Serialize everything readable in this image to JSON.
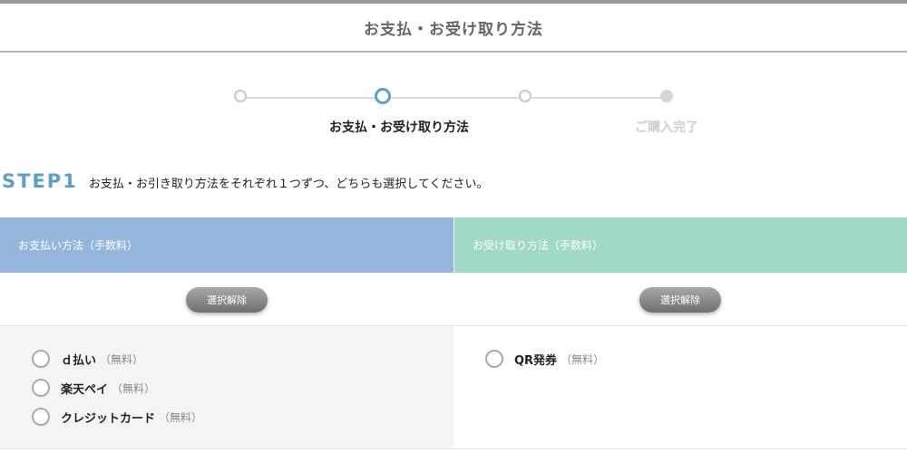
{
  "header": {
    "title": "お支払・お受け取り方法"
  },
  "stepper": {
    "current_label": "お支払・お受け取り方法",
    "final_label": "ご購入完了"
  },
  "step1": {
    "tag": "STEP1",
    "instruction": "お支払・お引き取り方法をそれぞれ１つずつ、どちらも選択してください。"
  },
  "payment": {
    "header": "お支払い方法（手数料）",
    "clear_label": "選択解除",
    "options": [
      {
        "name": "ｄ払い",
        "fee": "（無料）"
      },
      {
        "name": "楽天ペイ",
        "fee": "（無料）"
      },
      {
        "name": "クレジットカード",
        "fee": "（無料）"
      }
    ]
  },
  "receive": {
    "header": "お受け取り方法（手数料）",
    "clear_label": "選択解除",
    "options": [
      {
        "name": "QR発券",
        "fee": "（無料）"
      }
    ]
  }
}
